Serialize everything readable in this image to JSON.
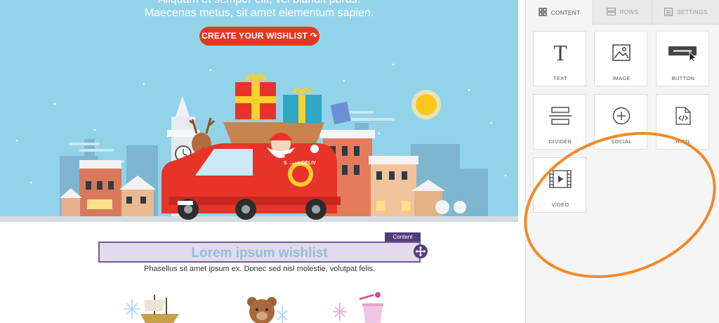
{
  "hero": {
    "line1": "Aliquam et semper elit, vel blandit purus.",
    "line2": "Maecenas metus, sit amet elementum sapien.",
    "cta_label": "CREATE YOUR WISHLIST ↷",
    "van_text": "SANTA DELIV"
  },
  "content_block": {
    "tag_label": "Content",
    "title": "Lorem ipsum wishlist",
    "subtitle": "Phasellus sit amet ipsum ex. Donec sed nisl molestie, volutpat felis."
  },
  "sidebar": {
    "tabs": [
      {
        "label": "CONTENT",
        "icon": "grid-icon",
        "active": true
      },
      {
        "label": "ROWS",
        "icon": "rows-icon",
        "active": false
      },
      {
        "label": "SETTINGS",
        "icon": "settings-icon",
        "active": false
      }
    ],
    "blocks": [
      {
        "label": "TEXT",
        "icon": "text-icon"
      },
      {
        "label": "IMAGE",
        "icon": "image-icon"
      },
      {
        "label": "BUTTON",
        "icon": "button-icon"
      },
      {
        "label": "DIVIDER",
        "icon": "divider-icon"
      },
      {
        "label": "SOCIAL",
        "icon": "social-plus-icon"
      },
      {
        "label": "HTML",
        "icon": "html-file-icon"
      },
      {
        "label": "VIDEO",
        "icon": "video-icon"
      }
    ]
  },
  "colors": {
    "hero_bg": "#93d3ea",
    "cta": "#e23a20",
    "selection": "#553c7b",
    "title_text": "#8bc2dc",
    "annotation": "#f08a2c"
  }
}
